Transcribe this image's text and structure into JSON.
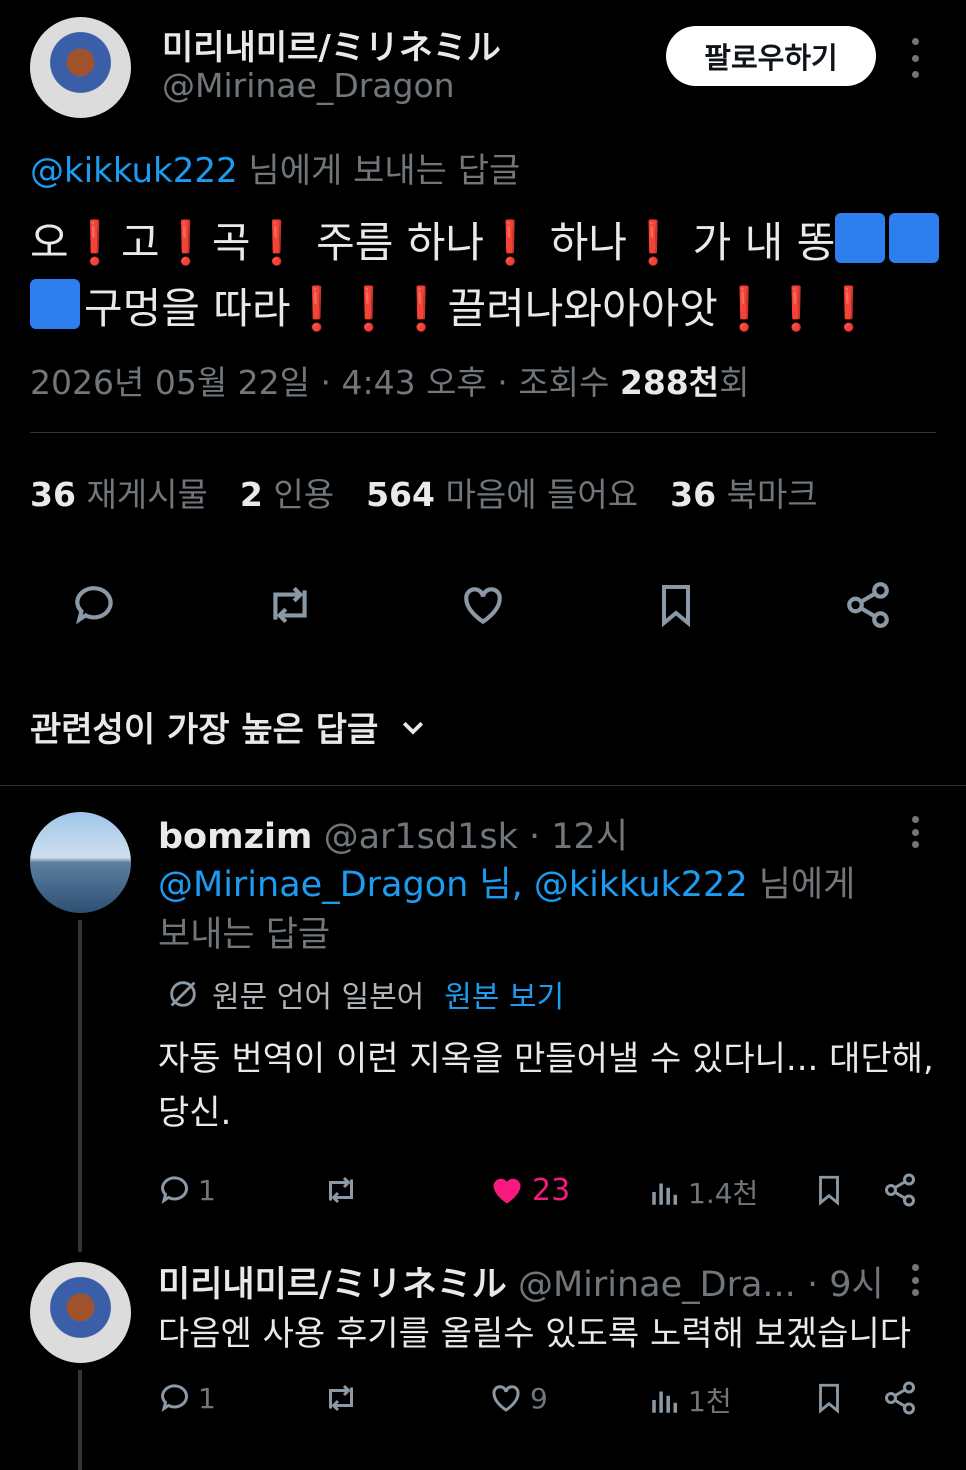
{
  "tweet": {
    "author_name": "미리내미르/ミリネミル",
    "author_handle": "@Mirinae_Dragon",
    "follow_label": "팔로우하기",
    "reply_to_handle": "@kikkuk222",
    "reply_to_suffix": " 님에게 보내는 답글",
    "text_parts": [
      "오",
      "고",
      "곡",
      " 주름 하나",
      " 하나",
      " 가 내 똥",
      "구멍을 따라",
      "끌려나와아아앗"
    ],
    "timestamp": "2026년 05월 22일 · 4:43 오후 · 조회수 ",
    "views_value": "288천",
    "views_suffix": "회",
    "stats": [
      {
        "value": "36",
        "label": "재게시물"
      },
      {
        "value": "2",
        "label": "인용"
      },
      {
        "value": "564",
        "label": "마음에 들어요"
      },
      {
        "value": "36",
        "label": "북마크"
      }
    ],
    "actions": [
      "reply-icon",
      "retweet-icon",
      "heart-icon",
      "bookmark-icon",
      "share-icon"
    ]
  },
  "sort": {
    "label": "관련성이 가장 높은 답글"
  },
  "replies": [
    {
      "author_name": "bomzim",
      "author_handle": "@ar1sd1sk",
      "time": " · 12시",
      "reply_to_links": "@Mirinae_Dragon 님, @kikkuk222",
      "reply_to_suffix": " 님에게",
      "reply_to_line2": "보내는 답글",
      "translation_note": "원문 언어 일본어",
      "show_original": "원본 보기",
      "text_line1": "자동 번역이 이런 지옥을 만들어낼 수 있다니... 대단해,",
      "text_line2": "당신.",
      "reply_count": "1",
      "like_count": "23",
      "view_count": "1.4천",
      "liked": true
    },
    {
      "author_name": "미리내미르/ミリネミル",
      "author_handle": "@Mirinae_Dra...",
      "time": " · 9시",
      "text": "다음엔 사용 후기를 올릴수 있도록 노력해 보겠습니다",
      "reply_count": "1",
      "like_count": "9",
      "view_count": "1천",
      "liked": false
    }
  ],
  "colors": {
    "background": "#000000",
    "link": "#1d9bf0",
    "muted": "#71767b",
    "like_active": "#f91880",
    "exclamation": "#e8253a",
    "wheelchair_badge": "#2d7ff0"
  }
}
